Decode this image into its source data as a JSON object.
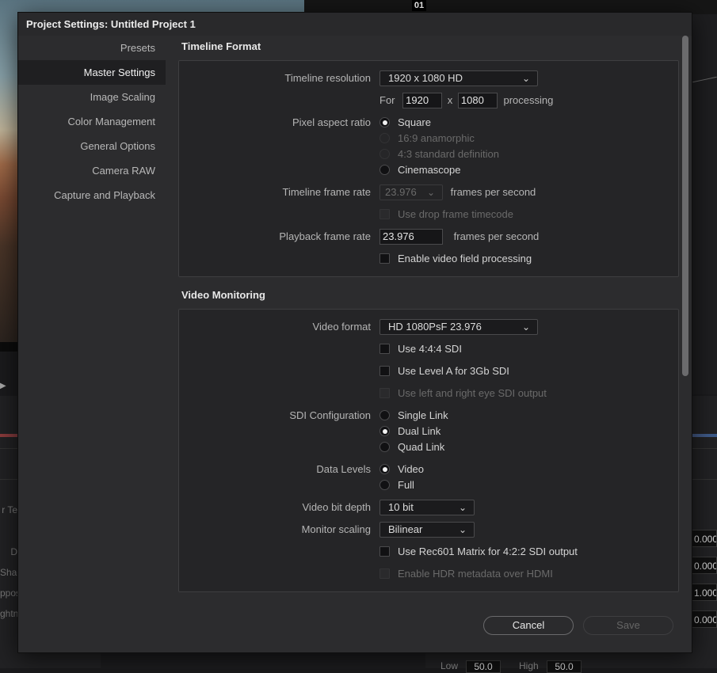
{
  "background": {
    "timecode": "01",
    "left_labels": [
      "r Te",
      "",
      "D",
      "Shad",
      "ppos",
      "ghtn"
    ],
    "right_values": [
      "0.000",
      "0.000",
      "1.000",
      "0.000"
    ],
    "low_label": "Low",
    "low_value": "50.0",
    "high_label": "High",
    "high_value": "50.0"
  },
  "dialog": {
    "title": "Project Settings:  Untitled Project 1",
    "sidebar": [
      {
        "label": "Presets"
      },
      {
        "label": "Master Settings"
      },
      {
        "label": "Image Scaling"
      },
      {
        "label": "Color Management"
      },
      {
        "label": "General Options"
      },
      {
        "label": "Camera RAW"
      },
      {
        "label": "Capture and Playback"
      }
    ],
    "timeline_format": {
      "title": "Timeline Format",
      "resolution_label": "Timeline resolution",
      "resolution_value": "1920 x 1080 HD",
      "for_label": "For",
      "width": "1920",
      "x_label": "x",
      "height": "1080",
      "processing_label": "processing",
      "pixel_aspect_label": "Pixel aspect ratio",
      "pixel_aspect_options": [
        "Square",
        "16:9 anamorphic",
        "4:3 standard definition",
        "Cinemascope"
      ],
      "frame_rate_label": "Timeline frame rate",
      "frame_rate_value": "23.976",
      "fps_label": "frames per second",
      "drop_frame_label": "Use drop frame timecode",
      "playback_rate_label": "Playback frame rate",
      "playback_rate_value": "23.976",
      "playback_fps_label": "frames per second",
      "field_processing_label": "Enable video field processing"
    },
    "video_monitoring": {
      "title": "Video Monitoring",
      "format_label": "Video format",
      "format_value": "HD 1080PsF 23.976",
      "use444_label": "Use 4:4:4 SDI",
      "levelA_label": "Use Level A for 3Gb SDI",
      "eye_label": "Use left and right eye SDI output",
      "sdi_config_label": "SDI Configuration",
      "sdi_options": [
        "Single Link",
        "Dual Link",
        "Quad Link"
      ],
      "data_levels_label": "Data Levels",
      "data_levels_options": [
        "Video",
        "Full"
      ],
      "bit_depth_label": "Video bit depth",
      "bit_depth_value": "10 bit",
      "scaling_label": "Monitor scaling",
      "scaling_value": "Bilinear",
      "rec601_label": "Use Rec601 Matrix for 4:2:2 SDI output",
      "hdr_label": "Enable HDR metadata over HDMI"
    },
    "buttons": {
      "cancel": "Cancel",
      "save": "Save"
    }
  }
}
